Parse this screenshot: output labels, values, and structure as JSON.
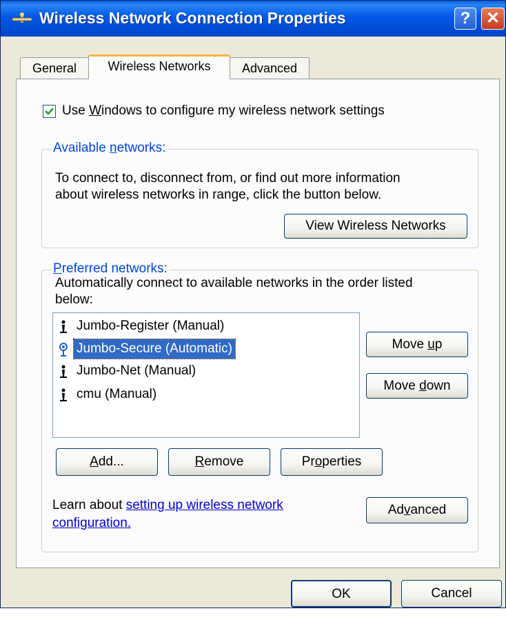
{
  "window": {
    "title": "Wireless Network Connection Properties"
  },
  "titlebar_buttons": {
    "help": "?",
    "close": "✕"
  },
  "tabs": [
    {
      "label": "General",
      "active": false
    },
    {
      "label": "Wireless Networks",
      "active": true
    },
    {
      "label": "Advanced",
      "active": false
    }
  ],
  "use_windows": {
    "checked": true,
    "label_pre": "Use ",
    "label_u": "W",
    "label_post": "indows to configure my wireless network settings"
  },
  "available": {
    "legend_pre": "Available ",
    "legend_u": "n",
    "legend_post": "etworks:",
    "desc_line1": "To connect to, disconnect from, or find out more information",
    "desc_line2": "about wireless networks in range, click the button below.",
    "view_button": "View Wireless Networks"
  },
  "preferred": {
    "legend_u": "P",
    "legend_post": "referred networks:",
    "desc_line1": "Automatically connect to available networks in the order listed",
    "desc_line2": "below:",
    "items": [
      {
        "label": "Jumbo-Register (Manual)",
        "icon": "manual-network-icon",
        "selected": false
      },
      {
        "label": "Jumbo-Secure (Automatic)",
        "icon": "automatic-network-icon",
        "selected": true
      },
      {
        "label": "Jumbo-Net (Manual)",
        "icon": "manual-network-icon",
        "selected": false
      },
      {
        "label": "cmu (Manual)",
        "icon": "manual-network-icon",
        "selected": false
      }
    ],
    "move_up_pre": "Move ",
    "move_up_u": "u",
    "move_up_post": "p",
    "move_down_pre": "Move ",
    "move_down_u": "d",
    "move_down_post": "own",
    "add_u": "A",
    "add_post": "dd...",
    "remove_u": "R",
    "remove_post": "emove",
    "properties_pre": "Pr",
    "properties_u": "o",
    "properties_post": "perties"
  },
  "learn": {
    "prefix": "Learn about ",
    "link_line1": "setting up wireless network",
    "link_line2": "configuration.",
    "advanced_pre": "Ad",
    "advanced_u": "v",
    "advanced_post": "anced"
  },
  "footer": {
    "ok": "OK",
    "cancel": "Cancel"
  },
  "colors": {
    "title_bar": "#0058e6",
    "selection": "#316ac5",
    "link": "#0000cc",
    "group_legend": "#0046d5"
  }
}
